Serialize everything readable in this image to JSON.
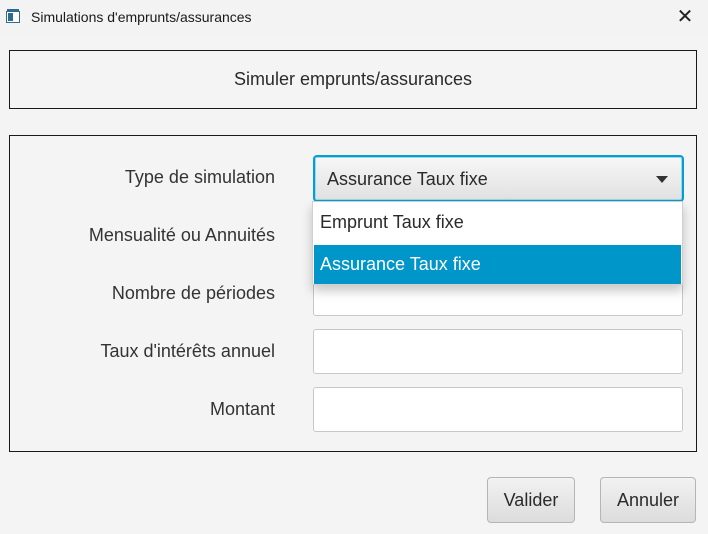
{
  "window": {
    "title": "Simulations d'emprunts/assurances",
    "close_symbol": "✕"
  },
  "header": {
    "title": "Simuler emprunts/assurances"
  },
  "form": {
    "type_label": "Type de simulation",
    "type_selected": "Assurance Taux fixe",
    "mensualite_label": "Mensualité ou Annuités",
    "periodes_label": "Nombre de périodes",
    "taux_label": "Taux d'intérêts annuel",
    "montant_label": "Montant",
    "periodes_value": "",
    "taux_value": "",
    "montant_value": ""
  },
  "dropdown": {
    "options": [
      "Emprunt Taux fixe",
      "Assurance Taux fixe"
    ],
    "highlighted_color": "#0096c9"
  },
  "buttons": {
    "valider": "Valider",
    "annuler": "Annuler"
  },
  "colors": {
    "focus_border": "#039ed3",
    "background": "#f4f4f4"
  }
}
